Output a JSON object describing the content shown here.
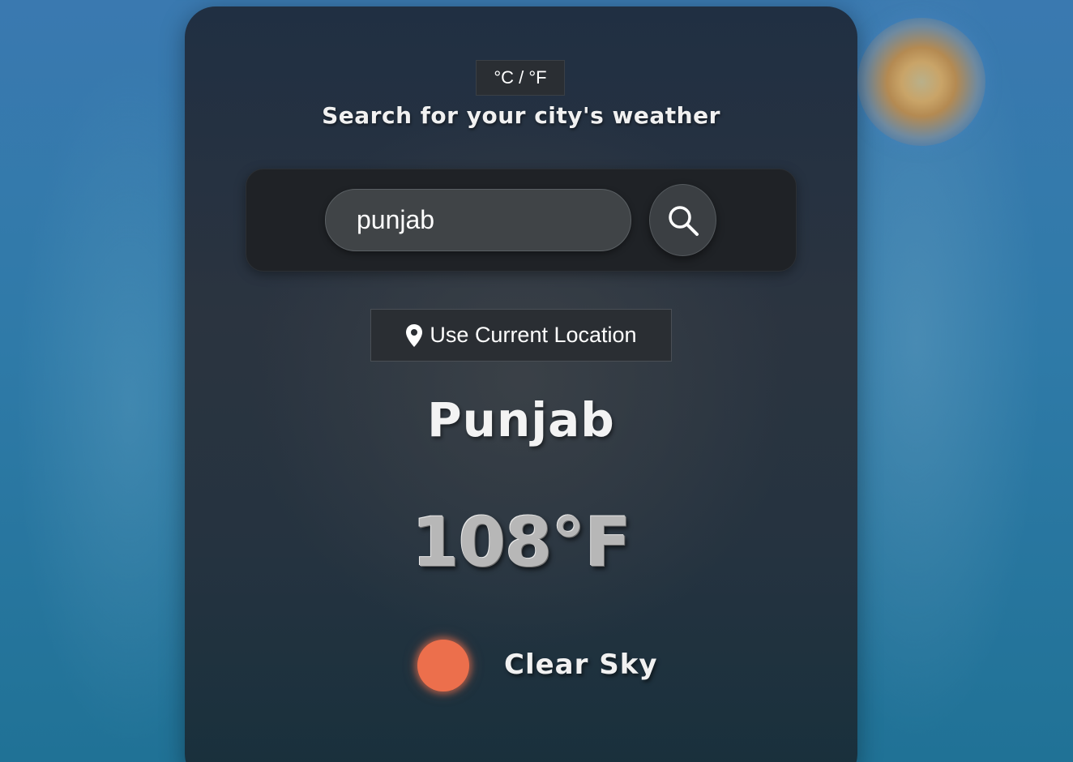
{
  "unit_toggle": {
    "label": "°C / °F"
  },
  "header": {
    "subtitle": "Search for your city's weather"
  },
  "search": {
    "value": "punjab",
    "button_icon": "search-icon"
  },
  "location": {
    "label": "Use Current Location",
    "icon": "map-pin-icon"
  },
  "weather": {
    "city": "Punjab",
    "temperature": "108°F",
    "condition": "Clear Sky",
    "condition_icon": "sun-icon",
    "condition_icon_color": "#ec6f4c"
  },
  "colors": {
    "card_background": "#2b3440",
    "search_panel": "#1f2226",
    "text_primary": "#f1f1f1"
  }
}
